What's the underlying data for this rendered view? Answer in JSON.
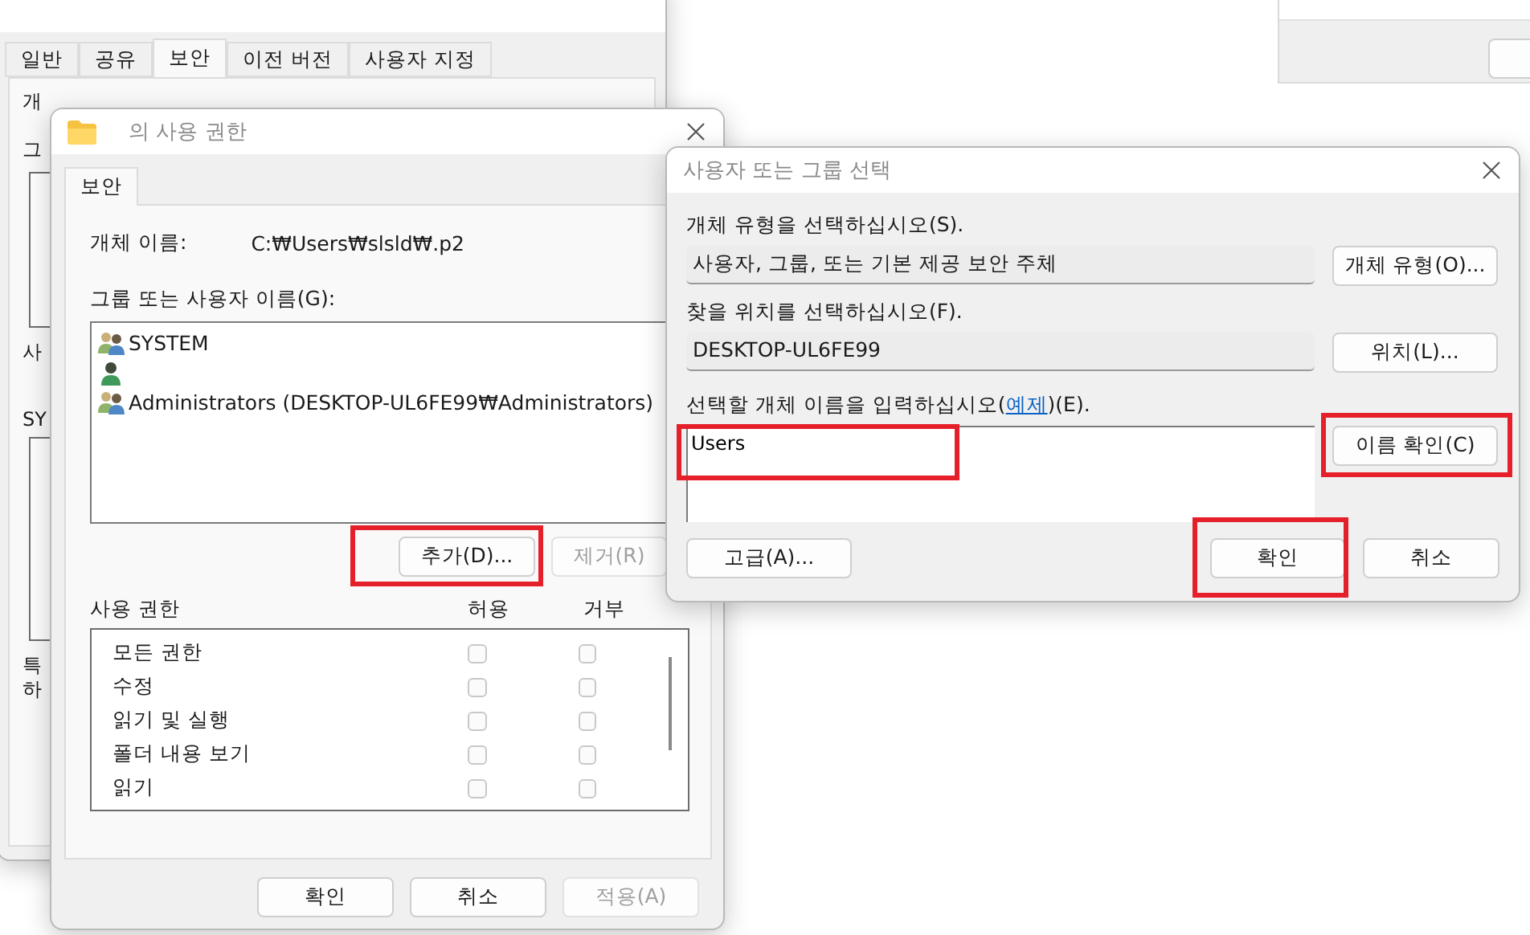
{
  "back_window": {
    "tabs": [
      {
        "label": "일반",
        "selected": false
      },
      {
        "label": "공유",
        "selected": false
      },
      {
        "label": "보안",
        "selected": true
      },
      {
        "label": "이전 버전",
        "selected": false
      },
      {
        "label": "사용자 지정",
        "selected": false
      }
    ],
    "peek_labels": [
      "개",
      "그",
      "사",
      "SY",
      "특",
      "하"
    ]
  },
  "permissions_window": {
    "title": "의 사용 권한",
    "tab": {
      "label": "보안",
      "selected": true
    },
    "object_name_label": "개체 이름:",
    "object_name": "C:₩Users₩slsld₩.p2",
    "group_label": "그룹 또는 사용자 이름(G):",
    "principals": [
      {
        "kind": "group",
        "name": "SYSTEM"
      },
      {
        "kind": "user"
      },
      {
        "kind": "group",
        "name": "Administrators (DESKTOP-UL6FE99₩Administrators)"
      }
    ],
    "add_button": {
      "label": "추가(D)...",
      "highlight": true
    },
    "remove_button": {
      "label": "제거(R)",
      "disabled": true
    },
    "permissions_header": {
      "name": "사용 권한",
      "allow": "허용",
      "deny": "거부"
    },
    "permissions": [
      {
        "name": "모든 권한",
        "allow": false,
        "deny": false
      },
      {
        "name": "수정",
        "allow": false,
        "deny": false
      },
      {
        "name": "읽기 및 실행",
        "allow": false,
        "deny": false
      },
      {
        "name": "폴더 내용 보기",
        "allow": false,
        "deny": false
      },
      {
        "name": "읽기",
        "allow": false,
        "deny": false
      }
    ],
    "buttons": [
      {
        "label": "확인",
        "disabled": false
      },
      {
        "label": "취소",
        "disabled": false
      },
      {
        "label": "적용(A)",
        "disabled": true
      }
    ]
  },
  "select_dialog": {
    "title": "사용자 또는 그룹 선택",
    "object_type_label": "개체 유형을 선택하십시오(S).",
    "object_type": "사용자, 그룹, 또는 기본 제공 보안 주체",
    "object_type_button": {
      "label": "개체 유형(O)..."
    },
    "location_label": "찾을 위치를 선택하십시오(F).",
    "location": "DESKTOP-UL6FE99",
    "location_button": {
      "label": "위치(L)..."
    },
    "names_label": "선택할 개체 이름을 입력하십시오(",
    "names_link": "예제",
    "names_label_end": ")(E).",
    "names_value": "Users",
    "names_highlight": true,
    "check_button": {
      "label": "이름 확인(C)",
      "highlight": true
    },
    "advanced_button": {
      "label": "고급(A)..."
    },
    "ok_button": {
      "label": "확인",
      "highlight": true
    },
    "cancel_button": {
      "label": "취소"
    }
  }
}
